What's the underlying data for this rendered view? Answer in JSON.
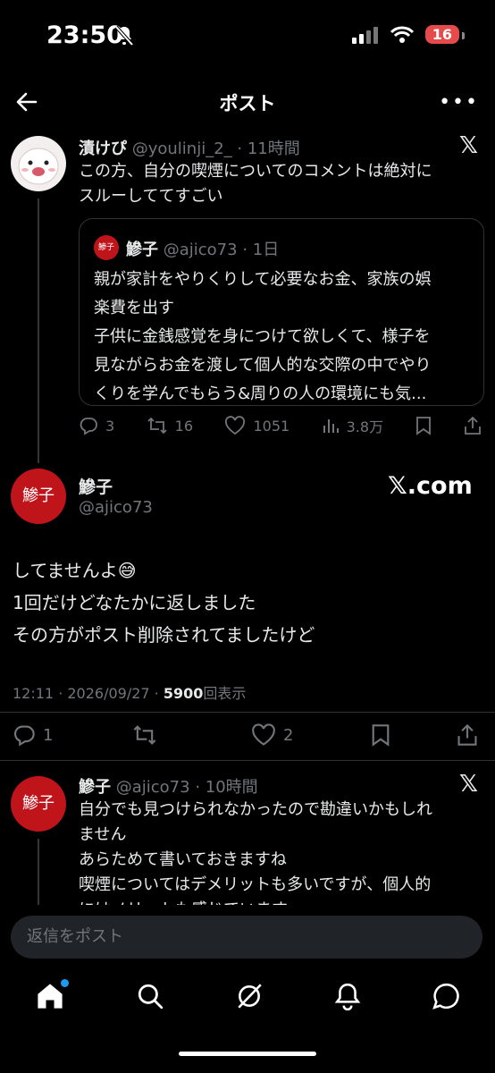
{
  "status_bar": {
    "time": "23:50",
    "battery": "16"
  },
  "header": {
    "title": "ポスト"
  },
  "parent_tweet": {
    "name": "漬けぴ",
    "handle": "@youlinji_2_",
    "time": "· 11時間",
    "text_line1": "この方、自分の喫煙についてのコメントは絶対に",
    "text_line2": "スルーしててすごい",
    "quote": {
      "name": "鰺子",
      "handle": "@ajico73",
      "time": "· 1日",
      "lines": [
        "親が家計をやりくりして必要なお金、家族の娯",
        "楽費を出す",
        "子供に金銭感覚を身につけて欲しくて、様子を",
        "見ながらお金を渡して個人的な交際の中でやり",
        "くりを学んでもらう&周りの人の環境にも気..."
      ]
    },
    "stats": {
      "replies": "3",
      "retweets": "16",
      "likes": "1051",
      "views": "3.8万"
    }
  },
  "main_tweet": {
    "name": "鰺子",
    "handle": "@ajico73",
    "brand": "𝕏.com",
    "lines": [
      "してませんよ😅",
      "1回だけどなたかに返しました",
      "その方がポスト削除されてましたけど"
    ],
    "meta_date": "12:11 · 2026/09/27 · ",
    "meta_views": "5900",
    "meta_views_label": "回表示",
    "stats": {
      "replies": "1",
      "likes": "2"
    }
  },
  "reply_tweet": {
    "name": "鰺子",
    "handle": "@ajico73",
    "time": "· 10時間",
    "lines": [
      "自分でも見つけられなかったので勘違いかもしれ",
      "ません",
      "あらためて書いておきますね",
      "喫煙についてはデメリットも多いですが、個人的",
      "にはメリットも感じています"
    ]
  },
  "reply_bar": {
    "placeholder": "返信をポスト"
  },
  "tabs": [
    "home-icon",
    "search-icon",
    "grok-icon",
    "notifications-icon",
    "messages-icon"
  ],
  "colors": {
    "accent": "#1d9bf0",
    "battery": "#e64b4b",
    "muted": "#71767b"
  },
  "avatar_text": "鯵子"
}
